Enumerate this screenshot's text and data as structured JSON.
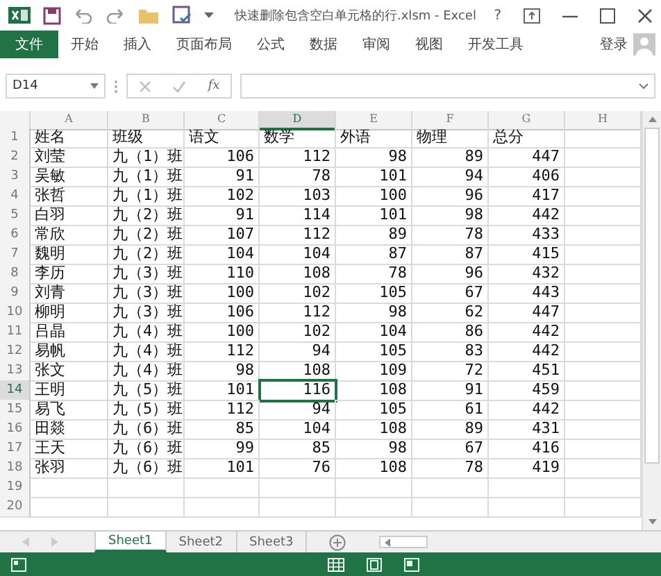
{
  "window": {
    "title": "快速删除包含空白单元格的行.xlsm - Excel",
    "help": "?"
  },
  "ribbon_tabs": [
    {
      "label": "文件",
      "kind": "file",
      "selected": false
    },
    {
      "label": "开始",
      "kind": "tab",
      "selected": false
    },
    {
      "label": "插入",
      "kind": "tab",
      "selected": false
    },
    {
      "label": "页面布局",
      "kind": "tab",
      "selected": false
    },
    {
      "label": "公式",
      "kind": "tab",
      "selected": false
    },
    {
      "label": "数据",
      "kind": "tab",
      "selected": false
    },
    {
      "label": "审阅",
      "kind": "tab",
      "selected": false
    },
    {
      "label": "视图",
      "kind": "tab",
      "selected": false
    },
    {
      "label": "开发工具",
      "kind": "tab",
      "selected": false
    }
  ],
  "sign_in": "登录",
  "formula_bar": {
    "name_box": "D14",
    "fx": "fx"
  },
  "sheet": {
    "columns": [
      {
        "label": "A",
        "kind": "text",
        "selected": false
      },
      {
        "label": "B",
        "kind": "text",
        "selected": false
      },
      {
        "label": "C",
        "kind": "number",
        "selected": false
      },
      {
        "label": "D",
        "kind": "number",
        "selected": true
      },
      {
        "label": "E",
        "kind": "number",
        "selected": false
      },
      {
        "label": "F",
        "kind": "number",
        "selected": false
      },
      {
        "label": "G",
        "kind": "number",
        "selected": false
      },
      {
        "label": "H",
        "selected": false
      }
    ],
    "rows": [
      {
        "number": "1",
        "kind": "header",
        "selected": false,
        "cells": [
          "姓名",
          "班级",
          "语文",
          "数学",
          "外语",
          "物理",
          "总分"
        ]
      },
      {
        "number": "2",
        "kind": "data",
        "selected": false,
        "cells": [
          "刘莹",
          "九（1）班",
          "106",
          "112",
          "98",
          "89",
          "447"
        ]
      },
      {
        "number": "3",
        "kind": "data",
        "selected": false,
        "cells": [
          "吴敏",
          "九（1）班",
          "91",
          "78",
          "101",
          "94",
          "406"
        ]
      },
      {
        "number": "4",
        "kind": "data",
        "selected": false,
        "cells": [
          "张哲",
          "九（1）班",
          "102",
          "103",
          "100",
          "96",
          "417"
        ]
      },
      {
        "number": "5",
        "kind": "data",
        "selected": false,
        "cells": [
          "白羽",
          "九（2）班",
          "91",
          "114",
          "101",
          "98",
          "442"
        ]
      },
      {
        "number": "6",
        "kind": "data",
        "selected": false,
        "cells": [
          "常欣",
          "九（2）班",
          "107",
          "112",
          "89",
          "78",
          "433"
        ]
      },
      {
        "number": "7",
        "kind": "data",
        "selected": false,
        "cells": [
          "魏明",
          "九（2）班",
          "104",
          "104",
          "87",
          "87",
          "415"
        ]
      },
      {
        "number": "8",
        "kind": "data",
        "selected": false,
        "cells": [
          "李历",
          "九（3）班",
          "110",
          "108",
          "78",
          "96",
          "432"
        ]
      },
      {
        "number": "9",
        "kind": "data",
        "selected": false,
        "cells": [
          "刘青",
          "九（3）班",
          "100",
          "102",
          "105",
          "67",
          "443"
        ]
      },
      {
        "number": "10",
        "kind": "data",
        "selected": false,
        "cells": [
          "柳明",
          "九（3）班",
          "106",
          "112",
          "98",
          "62",
          "447"
        ]
      },
      {
        "number": "11",
        "kind": "data",
        "selected": false,
        "cells": [
          "吕晶",
          "九（4）班",
          "100",
          "102",
          "104",
          "86",
          "442"
        ]
      },
      {
        "number": "12",
        "kind": "data",
        "selected": false,
        "cells": [
          "易帆",
          "九（4）班",
          "112",
          "94",
          "105",
          "83",
          "442"
        ]
      },
      {
        "number": "13",
        "kind": "data",
        "selected": false,
        "cells": [
          "张文",
          "九（4）班",
          "98",
          "108",
          "109",
          "72",
          "451"
        ]
      },
      {
        "number": "14",
        "kind": "data",
        "selected": true,
        "cells": [
          "王明",
          "九（5）班",
          "101",
          "116",
          "108",
          "91",
          "459"
        ]
      },
      {
        "number": "15",
        "kind": "data",
        "selected": false,
        "cells": [
          "易飞",
          "九（5）班",
          "112",
          "94",
          "105",
          "61",
          "442"
        ]
      },
      {
        "number": "16",
        "kind": "data",
        "selected": false,
        "cells": [
          "田燚",
          "九（6）班",
          "85",
          "104",
          "108",
          "89",
          "431"
        ]
      },
      {
        "number": "17",
        "kind": "data",
        "selected": false,
        "cells": [
          "王天",
          "九（6）班",
          "99",
          "85",
          "98",
          "67",
          "416"
        ]
      },
      {
        "number": "18",
        "kind": "data",
        "selected": false,
        "cells": [
          "张羽",
          "九（6）班",
          "101",
          "76",
          "108",
          "78",
          "419"
        ]
      },
      {
        "number": "19",
        "selected": false,
        "cells": []
      },
      {
        "number": "20",
        "selected": false,
        "cells": []
      }
    ]
  },
  "sheet_tabs": [
    {
      "label": "Sheet1",
      "selected": true
    },
    {
      "label": "Sheet2",
      "selected": false
    },
    {
      "label": "Sheet3",
      "selected": false
    }
  ]
}
